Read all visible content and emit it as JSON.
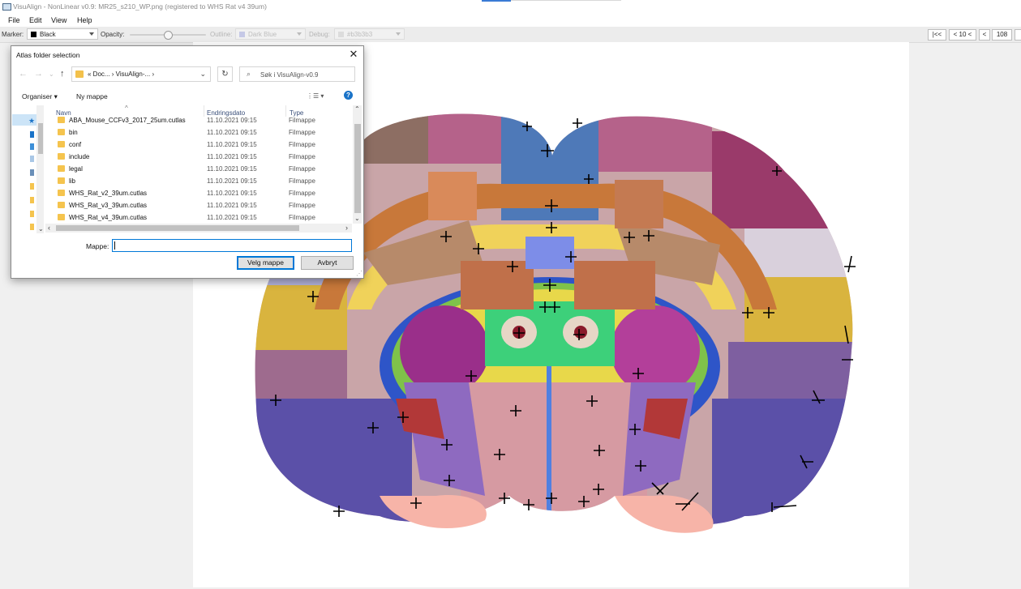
{
  "window": {
    "title": "VisuAlign - NonLinear v0.9: MR25_s210_WP.png (registered to WHS Rat v4 39um)"
  },
  "menu": [
    "File",
    "Edit",
    "View",
    "Help"
  ],
  "toolbar": {
    "marker_label": "Marker:",
    "marker_value": "Black",
    "marker_color": "#000000",
    "opacity_label": "Opacity:",
    "opacity_level": 0.49,
    "outline_label": "Outline:",
    "outline_value": "Dark Blue",
    "outline_color": "#8f95c8",
    "debug_label": "Debug:",
    "debug_value": "#b3b3b3",
    "debug_color": "#cccccc",
    "nav_first": "|<<",
    "nav_back10": "< 10 <",
    "nav_back": "<",
    "slice_number": "108"
  },
  "dialog": {
    "title": "Atlas folder selection",
    "path_crumbs": "«  Doc...  ›  VisuAlign-...  ›",
    "search_placeholder": "Søk i VisuAlign-v0.9",
    "organize_label": "Organiser ▾",
    "new_folder_label": "Ny mappe",
    "columns": {
      "name": "Navn",
      "date": "Endringsdato",
      "type": "Type"
    },
    "files": [
      {
        "name": "ABA_Mouse_CCFv3_2017_25um.cutlas",
        "date": "11.10.2021 09:15",
        "type": "Filmappe"
      },
      {
        "name": "bin",
        "date": "11.10.2021 09:15",
        "type": "Filmappe"
      },
      {
        "name": "conf",
        "date": "11.10.2021 09:15",
        "type": "Filmappe"
      },
      {
        "name": "include",
        "date": "11.10.2021 09:15",
        "type": "Filmappe"
      },
      {
        "name": "legal",
        "date": "11.10.2021 09:15",
        "type": "Filmappe"
      },
      {
        "name": "lib",
        "date": "11.10.2021 09:15",
        "type": "Filmappe"
      },
      {
        "name": "WHS_Rat_v2_39um.cutlas",
        "date": "11.10.2021 09:15",
        "type": "Filmappe"
      },
      {
        "name": "WHS_Rat_v3_39um.cutlas",
        "date": "11.10.2021 09:15",
        "type": "Filmappe"
      },
      {
        "name": "WHS_Rat_v4_39um.cutlas",
        "date": "11.10.2021 09:15",
        "type": "Filmappe"
      }
    ],
    "folder_label": "Mappe:",
    "folder_value": "",
    "select_button": "Velg mappe",
    "cancel_button": "Avbryt"
  },
  "colors": {
    "accent": "#0078d7",
    "folder": "#f5c44e"
  }
}
